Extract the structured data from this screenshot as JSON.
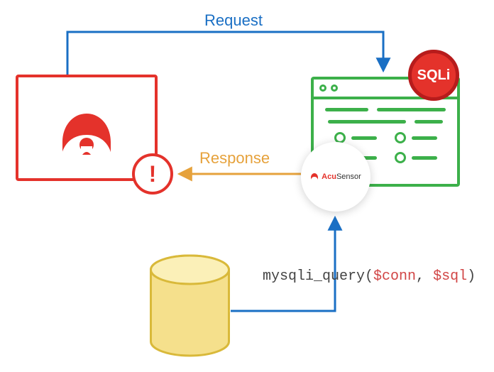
{
  "labels": {
    "request": "Request",
    "response": "Response",
    "sqli": "SQLi",
    "alert": "!"
  },
  "sensor": {
    "brand_prefix": "Acu",
    "brand_suffix": "Sensor"
  },
  "code": {
    "fn": "mysqli_query(",
    "arg1": "$conn",
    "sep": ", ",
    "arg2": "$sql",
    "end": ")"
  },
  "colors": {
    "red": "#e4322b",
    "green": "#3cb04a",
    "blue": "#1a6fc4",
    "orange": "#e6a23c",
    "db_fill": "#f5e08c",
    "db_stroke": "#d9b93a"
  }
}
